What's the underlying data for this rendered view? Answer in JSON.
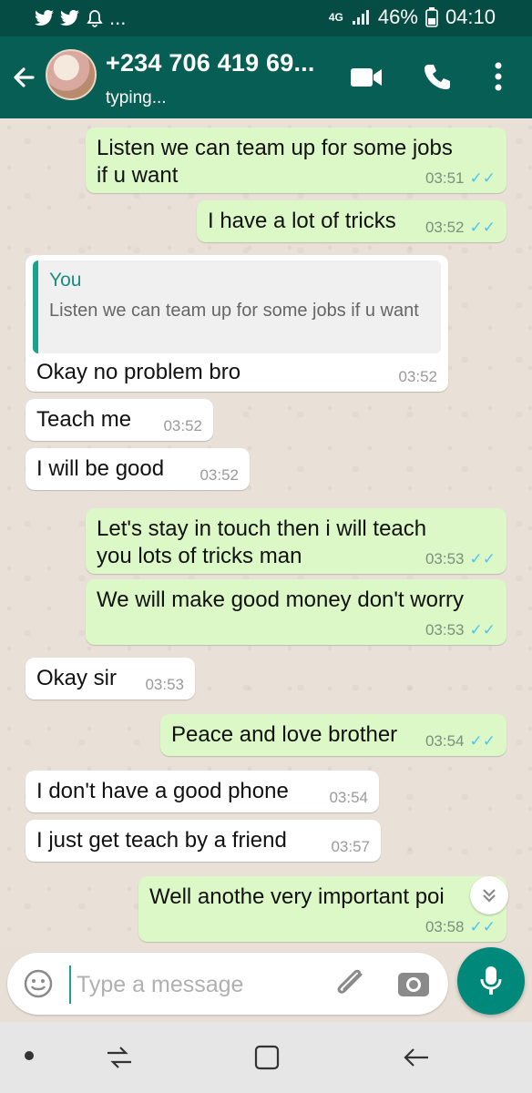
{
  "status_bar": {
    "network": "4G",
    "battery": "46%",
    "time": "04:10",
    "notifications": [
      "twitter-icon",
      "twitter-icon",
      "bell-icon"
    ],
    "more": "..."
  },
  "header": {
    "contact": "+234 706 419 69...",
    "status": "typing..."
  },
  "messages": [
    {
      "dir": "out",
      "text": "Listen we can team up for some jobs\nif u want",
      "time": "03:51",
      "ticks": "✓✓"
    },
    {
      "dir": "out",
      "text": "I have a lot of tricks",
      "time": "03:52",
      "ticks": "✓✓"
    },
    {
      "dir": "in",
      "quote_name": "You",
      "quote_text": "Listen we can team up for some jobs if u want",
      "text": "Okay no problem bro",
      "time": "03:52"
    },
    {
      "dir": "in",
      "text": "Teach me",
      "time": "03:52"
    },
    {
      "dir": "in",
      "text": "I will be good",
      "time": "03:52"
    },
    {
      "dir": "out",
      "text": "Let's stay in touch then i will teach\nyou lots of tricks man",
      "time": "03:53",
      "ticks": "✓✓"
    },
    {
      "dir": "out",
      "text": "We will make good money don't worry",
      "time": "03:53",
      "ticks": "✓✓"
    },
    {
      "dir": "in",
      "text": "Okay sir",
      "time": "03:53"
    },
    {
      "dir": "out",
      "text": "Peace and love brother",
      "time": "03:54",
      "ticks": "✓✓"
    },
    {
      "dir": "in",
      "text": "I don't have a good phone",
      "time": "03:54"
    },
    {
      "dir": "in",
      "text": "I just get teach by a friend",
      "time": "03:57"
    },
    {
      "dir": "out",
      "text": "Well anothe very important poi",
      "time": "03:58",
      "ticks": "✓✓"
    }
  ],
  "composer": {
    "placeholder": "Type a message"
  },
  "colors": {
    "header": "#075e54",
    "status_bar": "#054d44",
    "outgoing_bubble": "#dcf8c6",
    "incoming_bubble": "#ffffff",
    "accent": "#00897b",
    "read_ticks": "#4fc3f7"
  }
}
